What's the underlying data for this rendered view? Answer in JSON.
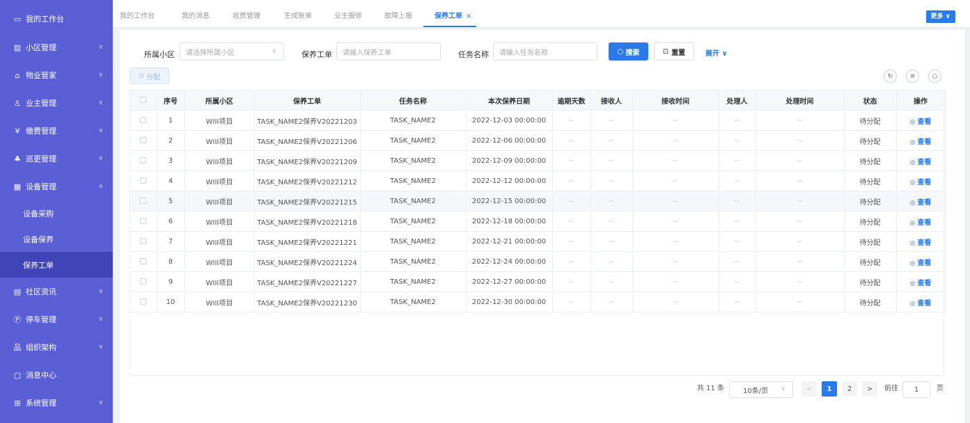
{
  "sidebar": {
    "items": [
      {
        "icon": "desktop-icon",
        "glyph": "▭",
        "label": "我的工作台",
        "chevron": ""
      },
      {
        "icon": "building-icon",
        "glyph": "▥",
        "label": "小区管理",
        "chevron": "∨"
      },
      {
        "icon": "home-icon",
        "glyph": "⌂",
        "label": "物业管家",
        "chevron": "∨"
      },
      {
        "icon": "user-icon",
        "glyph": "♙",
        "label": "业主管理",
        "chevron": "∨"
      },
      {
        "icon": "yen-icon",
        "glyph": "¥",
        "label": "缴费管理",
        "chevron": "∨"
      },
      {
        "icon": "patrol-icon",
        "glyph": "♣",
        "label": "巡更管理",
        "chevron": "∨"
      },
      {
        "icon": "device-icon",
        "glyph": "▦",
        "label": "设备管理",
        "chevron": "∧"
      }
    ],
    "sub_items": [
      "设备采购",
      "设备保养",
      "保养工单"
    ],
    "items_after": [
      {
        "icon": "news-icon",
        "glyph": "▤",
        "label": "社区资讯",
        "chevron": "∨"
      },
      {
        "icon": "parking-icon",
        "glyph": "Ⓟ",
        "label": "停车管理",
        "chevron": "∨"
      },
      {
        "icon": "org-icon",
        "glyph": "品",
        "label": "组织架构",
        "chevron": "∨"
      },
      {
        "icon": "message-icon",
        "glyph": "▢",
        "label": "消息中心",
        "chevron": ""
      },
      {
        "icon": "settings-icon",
        "glyph": "⊞",
        "label": "系统管理",
        "chevron": "∨"
      }
    ]
  },
  "tabs": [
    "我的工作台",
    "我的消息",
    "收费管理",
    "生成账单",
    "业主报修",
    "故障上报",
    "保养工单"
  ],
  "tab_close": "×",
  "more_label": "更多 ∨",
  "filters": {
    "community_label": "所属小区",
    "community_placeholder": "请选择所属小区",
    "order_label": "保养工单",
    "order_placeholder": "请输入保养工单",
    "task_label": "任务名称",
    "task_placeholder": "请输入任务名称",
    "search_label": "搜索",
    "reset_label": "重置",
    "expand_label": "展开 ∨"
  },
  "assign_label": "分配",
  "table": {
    "headers": [
      "",
      "序号",
      "所属小区",
      "保养工单",
      "任务名称",
      "本次保养日期",
      "逾期天数",
      "接收人",
      "接收时间",
      "处理人",
      "处理时间",
      "状态",
      "操作"
    ],
    "rows": [
      {
        "no": "1",
        "community": "WIII项目",
        "order": "TASK_NAME2保养V20221203",
        "task": "TASK_NAME2",
        "date": "2022-12-03 00:00:00",
        "overdue": "--",
        "receiver": "--",
        "recv_time": "--",
        "handler": "--",
        "handle_time": "--",
        "status": "待分配",
        "action": "查看"
      },
      {
        "no": "2",
        "community": "WIII项目",
        "order": "TASK_NAME2保养V20221206",
        "task": "TASK_NAME2",
        "date": "2022-12-06 00:00:00",
        "overdue": "--",
        "receiver": "--",
        "recv_time": "--",
        "handler": "--",
        "handle_time": "--",
        "status": "待分配",
        "action": "查看"
      },
      {
        "no": "3",
        "community": "WIII项目",
        "order": "TASK_NAME2保养V20221209",
        "task": "TASK_NAME2",
        "date": "2022-12-09 00:00:00",
        "overdue": "--",
        "receiver": "--",
        "recv_time": "--",
        "handler": "--",
        "handle_time": "--",
        "status": "待分配",
        "action": "查看"
      },
      {
        "no": "4",
        "community": "WIII项目",
        "order": "TASK_NAME2保养V20221212",
        "task": "TASK_NAME2",
        "date": "2022-12-12 00:00:00",
        "overdue": "--",
        "receiver": "--",
        "recv_time": "--",
        "handler": "--",
        "handle_time": "--",
        "status": "待分配",
        "action": "查看"
      },
      {
        "no": "5",
        "community": "WIII项目",
        "order": "TASK_NAME2保养V20221215",
        "task": "TASK_NAME2",
        "date": "2022-12-15 00:00:00",
        "overdue": "--",
        "receiver": "--",
        "recv_time": "--",
        "handler": "--",
        "handle_time": "--",
        "status": "待分配",
        "action": "查看"
      },
      {
        "no": "6",
        "community": "WIII项目",
        "order": "TASK_NAME2保养V20221218",
        "task": "TASK_NAME2",
        "date": "2022-12-18 00:00:00",
        "overdue": "--",
        "receiver": "--",
        "recv_time": "--",
        "handler": "--",
        "handle_time": "--",
        "status": "待分配",
        "action": "查看"
      },
      {
        "no": "7",
        "community": "WIII项目",
        "order": "TASK_NAME2保养V20221221",
        "task": "TASK_NAME2",
        "date": "2022-12-21 00:00:00",
        "overdue": "--",
        "receiver": "--",
        "recv_time": "--",
        "handler": "--",
        "handle_time": "--",
        "status": "待分配",
        "action": "查看"
      },
      {
        "no": "8",
        "community": "WIII项目",
        "order": "TASK_NAME2保养V20221224",
        "task": "TASK_NAME2",
        "date": "2022-12-24 00:00:00",
        "overdue": "--",
        "receiver": "--",
        "recv_time": "--",
        "handler": "--",
        "handle_time": "--",
        "status": "待分配",
        "action": "查看"
      },
      {
        "no": "9",
        "community": "WIII项目",
        "order": "TASK_NAME2保养V20221227",
        "task": "TASK_NAME2",
        "date": "2022-12-27 00:00:00",
        "overdue": "--",
        "receiver": "--",
        "recv_time": "--",
        "handler": "--",
        "handle_time": "--",
        "status": "待分配",
        "action": "查看"
      },
      {
        "no": "10",
        "community": "WIII项目",
        "order": "TASK_NAME2保养V20221230",
        "task": "TASK_NAME2",
        "date": "2022-12-30 00:00:00",
        "overdue": "--",
        "receiver": "--",
        "recv_time": "--",
        "handler": "--",
        "handle_time": "--",
        "status": "待分配",
        "action": "查看"
      }
    ]
  },
  "pagination": {
    "total": "共 11 条",
    "page_size": "10条/页",
    "prev": "<",
    "pages": [
      "1",
      "2"
    ],
    "current": "1",
    "next": ">",
    "goto_label": "前往",
    "goto_value": "1",
    "page_suffix": "页"
  },
  "colors": {
    "sidebar_bg": "#5a5fd6",
    "sidebar_active": "#3f44b6",
    "accent": "#2a7be8"
  }
}
